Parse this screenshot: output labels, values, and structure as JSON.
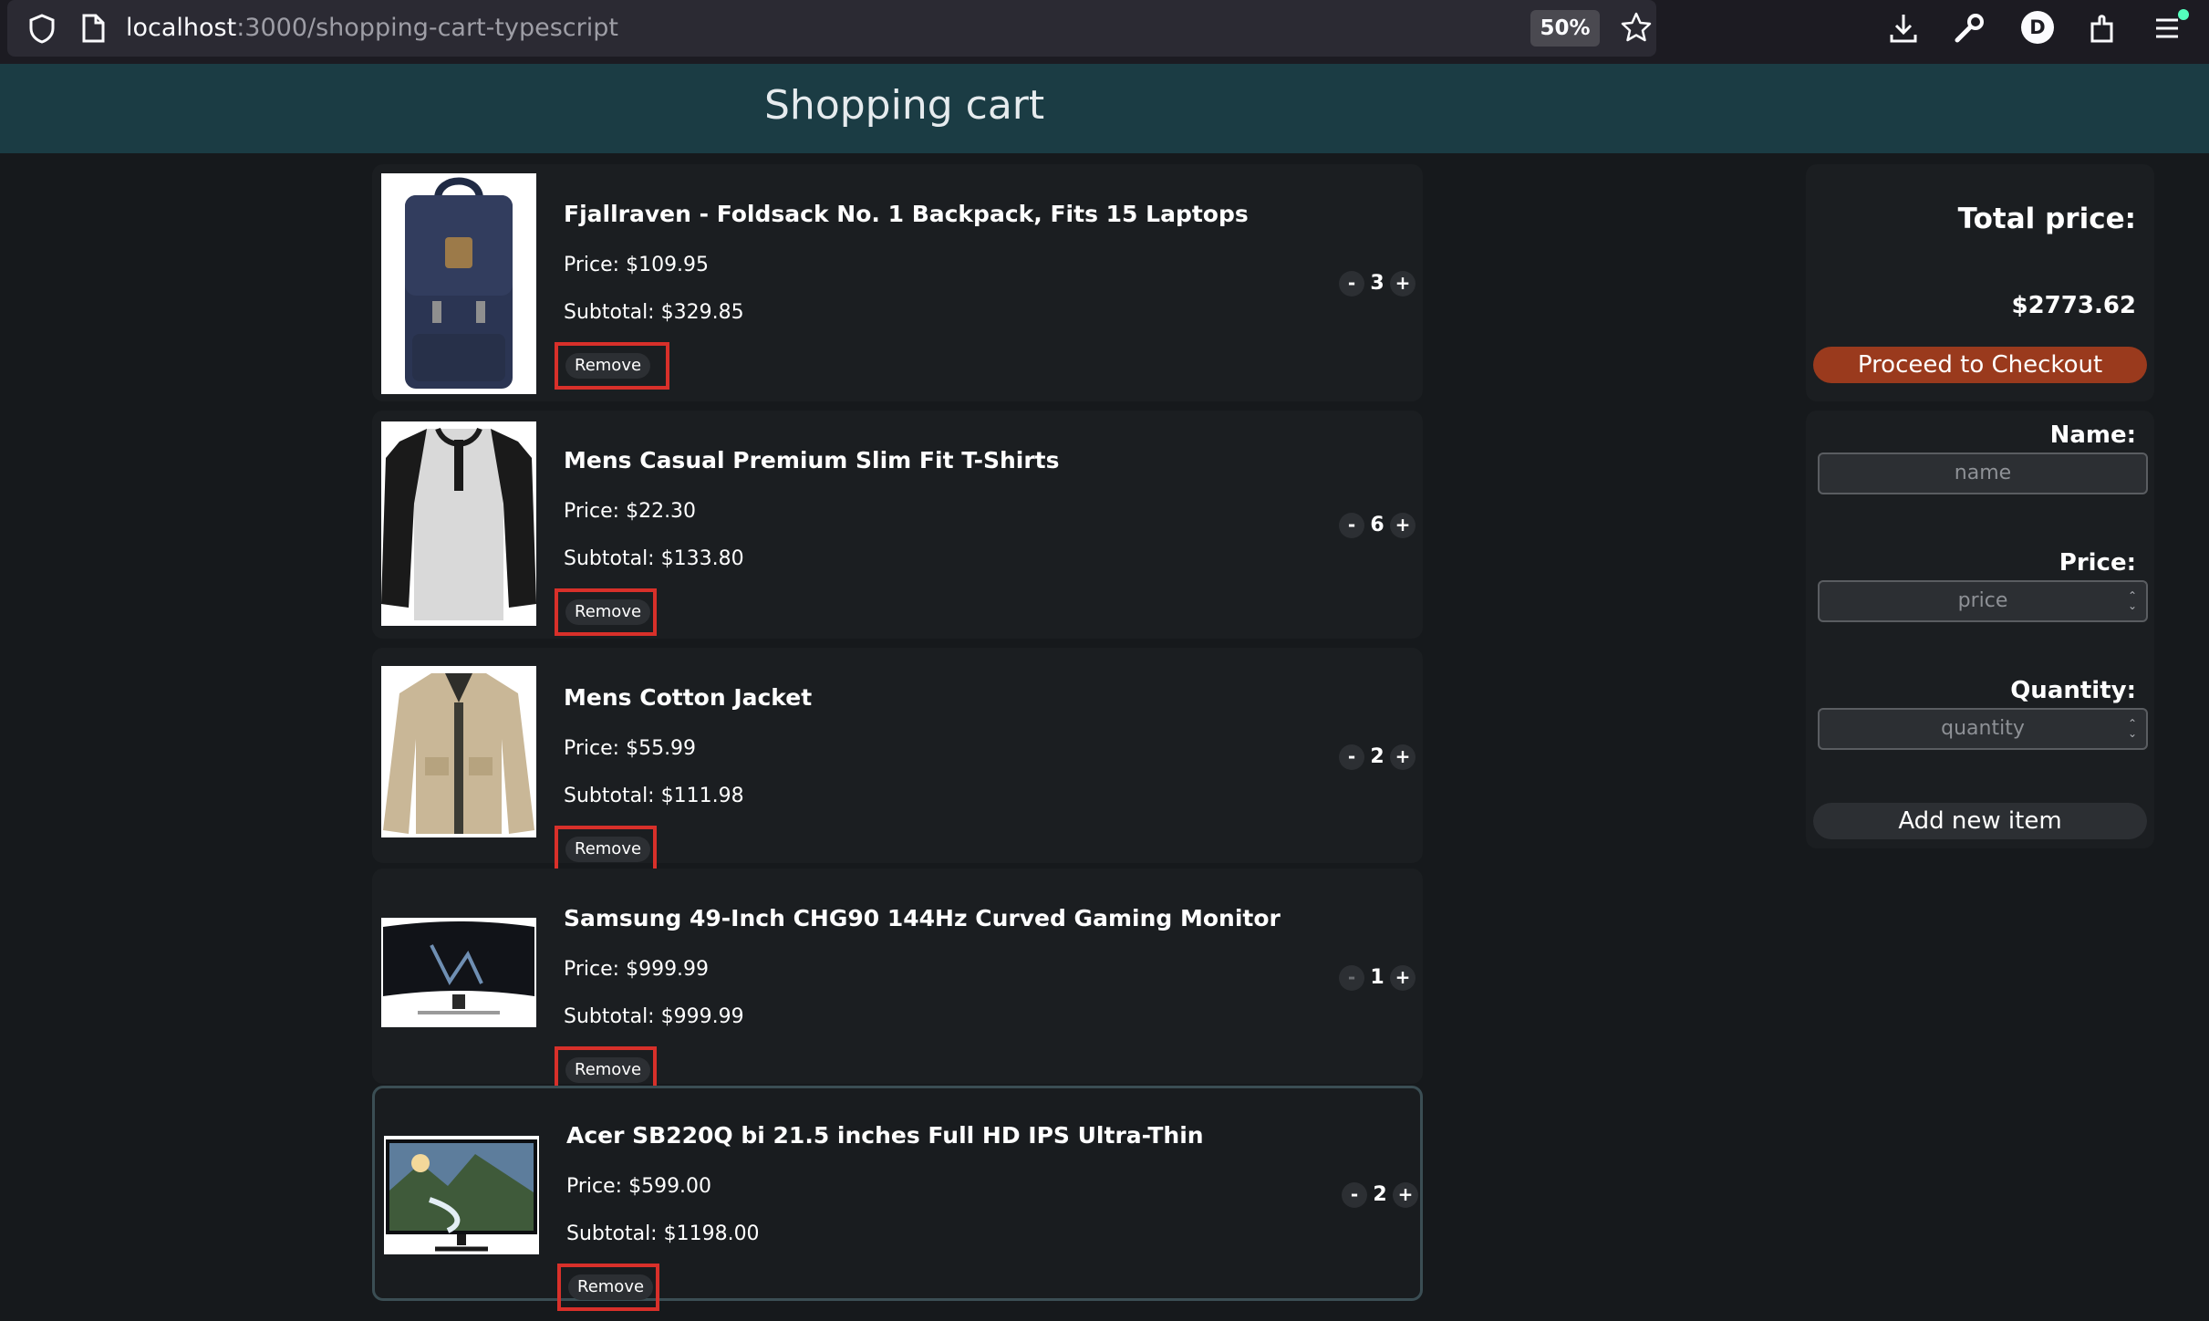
{
  "browser": {
    "url_host": "localhost",
    "url_path": ":3000/shopping-cart-typescript",
    "zoom": "50%",
    "avatar_initial": "D"
  },
  "header": {
    "title": "Shopping cart"
  },
  "cart": {
    "remove_label": "Remove",
    "minus_label": "-",
    "plus_label": "+",
    "items": [
      {
        "title": "Fjallraven - Foldsack No. 1 Backpack, Fits 15 Laptops",
        "price": "Price: $109.95",
        "subtotal": "Subtotal: $329.85",
        "quantity": "3",
        "image": "backpack"
      },
      {
        "title": "Mens Casual Premium Slim Fit T-Shirts",
        "price": "Price: $22.30",
        "subtotal": "Subtotal: $133.80",
        "quantity": "6",
        "image": "tshirt"
      },
      {
        "title": "Mens Cotton Jacket",
        "price": "Price: $55.99",
        "subtotal": "Subtotal: $111.98",
        "quantity": "2",
        "image": "jacket"
      },
      {
        "title": "Samsung 49-Inch CHG90 144Hz Curved Gaming Monitor",
        "price": "Price: $999.99",
        "subtotal": "Subtotal: $999.99",
        "quantity": "1",
        "image": "curved-monitor"
      },
      {
        "title": "Acer SB220Q bi 21.5 inches Full HD IPS Ultra-Thin",
        "price": "Price: $599.00",
        "subtotal": "Subtotal: $1198.00",
        "quantity": "2",
        "image": "monitor"
      }
    ]
  },
  "summary": {
    "total_label": "Total price:",
    "total_value": "$2773.62",
    "checkout_label": "Proceed to Checkout"
  },
  "form": {
    "name_label": "Name:",
    "name_placeholder": "name",
    "price_label": "Price:",
    "price_placeholder": "price",
    "quantity_label": "Quantity:",
    "quantity_placeholder": "quantity",
    "add_label": "Add new item"
  },
  "colors": {
    "header_bg": "#1b3c44",
    "checkout_bg": "#9a3a1d",
    "highlight_outline": "#d8302a"
  }
}
